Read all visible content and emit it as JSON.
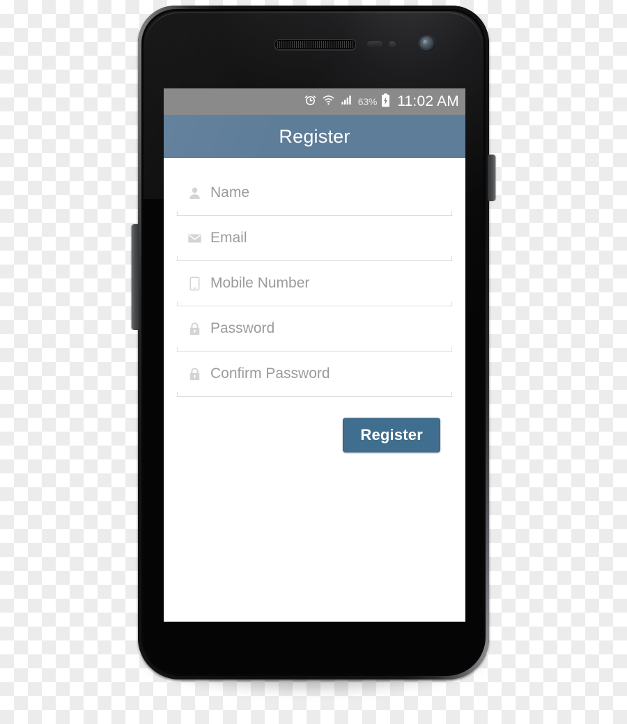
{
  "device": {
    "name": "android-smartphone",
    "hardware": {
      "earpiece": "earpiece-speaker",
      "proximity_sensor": "proximity-sensor",
      "light_sensor": "light-sensor",
      "front_camera": "front-camera",
      "volume_key": "volume-rocker",
      "power_key": "power-button"
    }
  },
  "status_bar": {
    "icons": [
      "alarm-icon",
      "wifi-icon",
      "signal-icon",
      "battery-icon"
    ],
    "battery_percent": "63%",
    "clock": "11:02 AM",
    "background_color": "#8a8a8a",
    "text_color": "#ffffff"
  },
  "app_bar": {
    "title": "Register",
    "background_color": "#5e7d99",
    "text_color": "#ffffff"
  },
  "form": {
    "fields": [
      {
        "id": "name",
        "icon": "person-icon",
        "placeholder": "Name",
        "value": ""
      },
      {
        "id": "email",
        "icon": "envelope-icon",
        "placeholder": "Email",
        "value": ""
      },
      {
        "id": "mobile",
        "icon": "smartphone-icon",
        "placeholder": "Mobile Number",
        "value": ""
      },
      {
        "id": "password",
        "icon": "lock-icon",
        "placeholder": "Password",
        "value": ""
      },
      {
        "id": "confirm_password",
        "icon": "lock-icon",
        "placeholder": "Confirm Password",
        "value": ""
      }
    ],
    "icon_color": "#d4d4d4",
    "placeholder_color": "#9b9b9b",
    "underline_color": "#dedede"
  },
  "submit": {
    "label": "Register",
    "background_color": "#3f6e8e",
    "text_color": "#ffffff"
  }
}
